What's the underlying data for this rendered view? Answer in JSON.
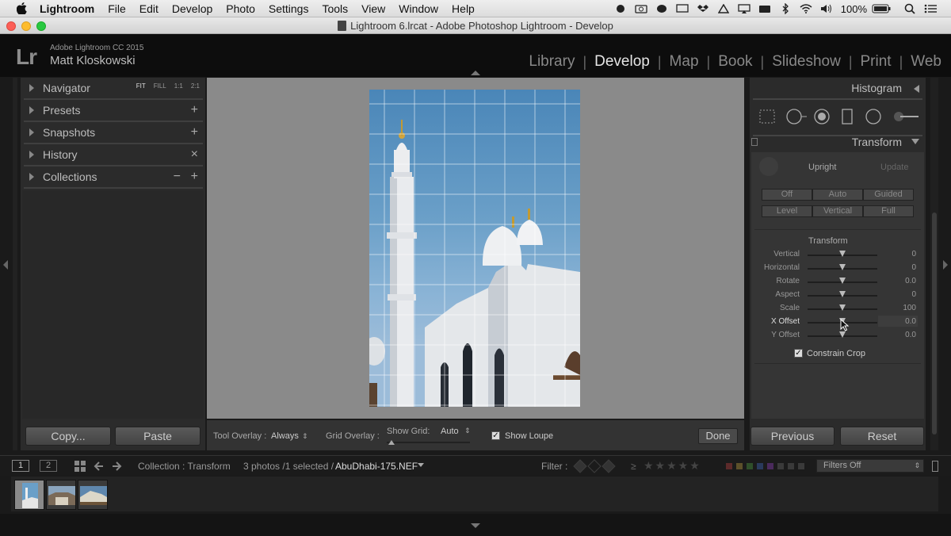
{
  "menubar": {
    "app_name": "Lightroom",
    "items": [
      "File",
      "Edit",
      "Develop",
      "Photo",
      "Settings",
      "Tools",
      "View",
      "Window",
      "Help"
    ],
    "battery": "100%"
  },
  "window": {
    "title": "Lightroom 6.lrcat - Adobe Photoshop Lightroom - Develop"
  },
  "identity": {
    "logo": "Lr",
    "product": "Adobe Lightroom CC 2015",
    "user": "Matt Kloskowski"
  },
  "modules": {
    "items": [
      "Library",
      "Develop",
      "Map",
      "Book",
      "Slideshow",
      "Print",
      "Web"
    ],
    "active": "Develop",
    "separator": "|"
  },
  "left_panel": {
    "navigator": {
      "label": "Navigator",
      "zoom_options": [
        "FIT",
        "FILL",
        "1:1",
        "2:1"
      ]
    },
    "presets": {
      "label": "Presets",
      "action": "+"
    },
    "snapshots": {
      "label": "Snapshots",
      "action": "+"
    },
    "history": {
      "label": "History",
      "action": "×"
    },
    "collections": {
      "label": "Collections",
      "action_minus": "−",
      "action_plus": "+"
    },
    "copy_button": "Copy...",
    "paste_button": "Paste"
  },
  "toolbar": {
    "tool_overlay_label": "Tool Overlay :",
    "tool_overlay_value": "Always",
    "grid_overlay_label": "Grid Overlay :",
    "show_grid_label": "Show Grid:",
    "show_grid_value": "Auto",
    "show_loupe_label": "Show Loupe",
    "show_loupe_checked": true,
    "done_button": "Done"
  },
  "right_panel": {
    "histogram_label": "Histogram",
    "transform_label": "Transform",
    "upright": {
      "label": "Upright",
      "update": "Update",
      "row1": [
        "Off",
        "Auto",
        "Guided"
      ],
      "row2": [
        "Level",
        "Vertical",
        "Full"
      ]
    },
    "transform_section_label": "Transform",
    "sliders": [
      {
        "label": "Vertical",
        "value": "0"
      },
      {
        "label": "Horizontal",
        "value": "0"
      },
      {
        "label": "Rotate",
        "value": "0.0"
      },
      {
        "label": "Aspect",
        "value": "0"
      },
      {
        "label": "Scale",
        "value": "100"
      },
      {
        "label": "X Offset",
        "value": "0.0"
      },
      {
        "label": "Y Offset",
        "value": "0.0"
      }
    ],
    "constrain_crop_label": "Constrain Crop",
    "constrain_crop_checked": true,
    "previous_button": "Previous",
    "reset_button": "Reset"
  },
  "filmstrip": {
    "view1": "1",
    "view2": "2",
    "source": "Collection : Transform",
    "count": "3 photos /1 selected /",
    "filename": "AbuDhabi-175.NEF",
    "filter_label": "Filter :",
    "filters_value": "Filters Off"
  }
}
